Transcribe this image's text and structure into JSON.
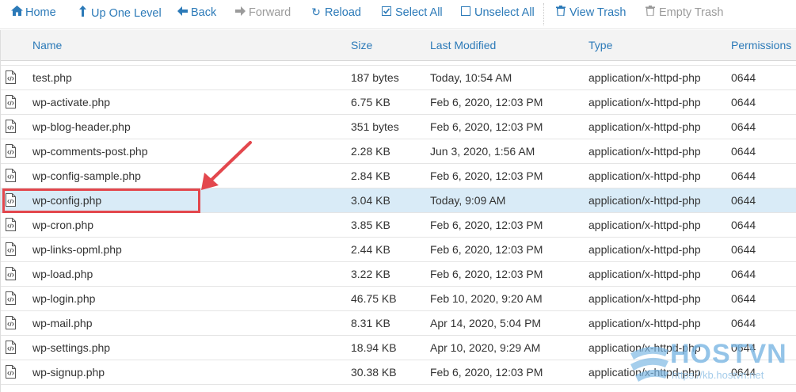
{
  "toolbar": {
    "home": "Home",
    "up": "Up One Level",
    "back": "Back",
    "forward": "Forward",
    "reload": "Reload",
    "select_all": "Select All",
    "unselect_all": "Unselect All",
    "view_trash": "View Trash",
    "empty_trash": "Empty Trash"
  },
  "columns": {
    "name": "Name",
    "size": "Size",
    "modified": "Last Modified",
    "type": "Type",
    "permissions": "Permissions"
  },
  "files": [
    {
      "name": "test.php",
      "size": "187 bytes",
      "modified": "Today, 10:54 AM",
      "type": "application/x-httpd-php",
      "perm": "0644"
    },
    {
      "name": "wp-activate.php",
      "size": "6.75 KB",
      "modified": "Feb 6, 2020, 12:03 PM",
      "type": "application/x-httpd-php",
      "perm": "0644"
    },
    {
      "name": "wp-blog-header.php",
      "size": "351 bytes",
      "modified": "Feb 6, 2020, 12:03 PM",
      "type": "application/x-httpd-php",
      "perm": "0644"
    },
    {
      "name": "wp-comments-post.php",
      "size": "2.28 KB",
      "modified": "Jun 3, 2020, 1:56 AM",
      "type": "application/x-httpd-php",
      "perm": "0644"
    },
    {
      "name": "wp-config-sample.php",
      "size": "2.84 KB",
      "modified": "Feb 6, 2020, 12:03 PM",
      "type": "application/x-httpd-php",
      "perm": "0644"
    },
    {
      "name": "wp-config.php",
      "size": "3.04 KB",
      "modified": "Today, 9:09 AM",
      "type": "application/x-httpd-php",
      "perm": "0644"
    },
    {
      "name": "wp-cron.php",
      "size": "3.85 KB",
      "modified": "Feb 6, 2020, 12:03 PM",
      "type": "application/x-httpd-php",
      "perm": "0644"
    },
    {
      "name": "wp-links-opml.php",
      "size": "2.44 KB",
      "modified": "Feb 6, 2020, 12:03 PM",
      "type": "application/x-httpd-php",
      "perm": "0644"
    },
    {
      "name": "wp-load.php",
      "size": "3.22 KB",
      "modified": "Feb 6, 2020, 12:03 PM",
      "type": "application/x-httpd-php",
      "perm": "0644"
    },
    {
      "name": "wp-login.php",
      "size": "46.75 KB",
      "modified": "Feb 10, 2020, 9:20 AM",
      "type": "application/x-httpd-php",
      "perm": "0644"
    },
    {
      "name": "wp-mail.php",
      "size": "8.31 KB",
      "modified": "Apr 14, 2020, 5:04 PM",
      "type": "application/x-httpd-php",
      "perm": "0644"
    },
    {
      "name": "wp-settings.php",
      "size": "18.94 KB",
      "modified": "Apr 10, 2020, 9:29 AM",
      "type": "application/x-httpd-php",
      "perm": "0644"
    },
    {
      "name": "wp-signup.php",
      "size": "30.38 KB",
      "modified": "Feb 6, 2020, 12:03 PM",
      "type": "application/x-httpd-php",
      "perm": "0644"
    }
  ],
  "selected_file": "wp-config.php",
  "watermark": {
    "brand": "HOSTVN",
    "url": "https://kb.hostvn.net"
  },
  "colors": {
    "link": "#2c7ab8",
    "selected_row": "#d9ebf7",
    "annotation": "#e3474d"
  }
}
